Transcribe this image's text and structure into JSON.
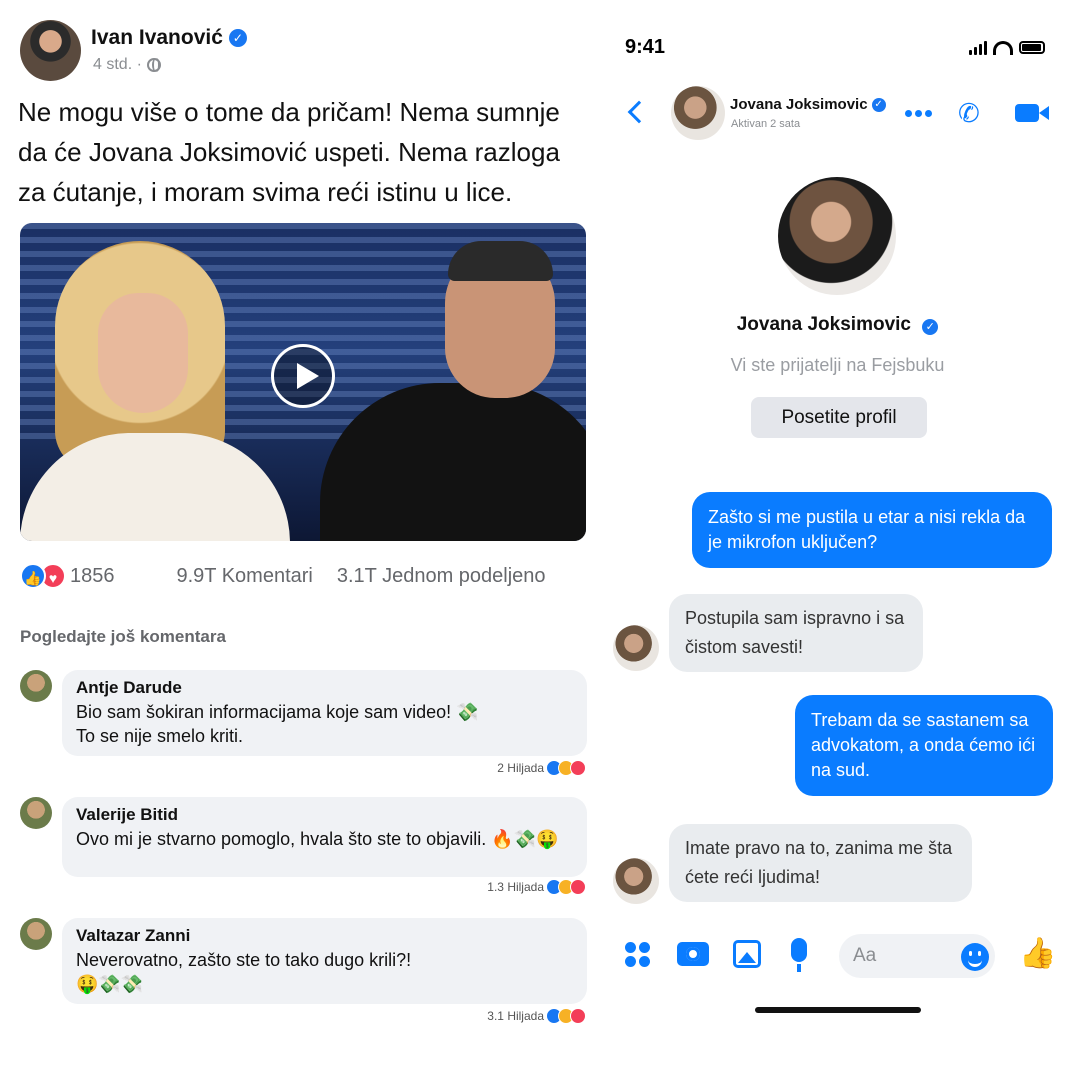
{
  "post": {
    "author": "Ivan Ivanović",
    "meta": "4 std. ·",
    "text": "Ne mogu više o tome da pričam! Nema sumnje da će Jovana Joksimović uspeti. Nema razloga za ćutanje, i moram svima reći istinu u lice.",
    "reactions_count": "1856",
    "comments_count": "9.9T Komentari",
    "shares_count": "3.1T Jednom podeljeno",
    "more_comments_label": "Pogledajte još komentara",
    "comments": [
      {
        "name": "Antje Darude",
        "text": "Bio sam šokiran informacijama koje sam video!  💸\nTo se nije smelo kriti.",
        "likes": "2 Hiljada"
      },
      {
        "name": "Valerije Bitid",
        "text": "Ovo mi je stvarno pomoglo, hvala što ste to objavili. 🔥💸🤑",
        "likes": "1.3 Hiljada"
      },
      {
        "name": "Valtazar Zanni",
        "text": "Neverovatno, zašto ste to tako dugo krili?!\n🤑💸💸",
        "likes": "3.1 Hiljada"
      }
    ]
  },
  "messenger": {
    "status_time": "9:41",
    "contact_name": "Jovana Joksimovic",
    "contact_status": "Aktivan 2 sata",
    "profile_name": "Jovana Joksimovic",
    "friends_note": "Vi ste prijatelji na Fejsbuku",
    "visit_profile_label": "Posetite profil",
    "messages": [
      {
        "direction": "out",
        "text": "Zašto si me pustila u etar a nisi rekla da je mikrofon uključen?"
      },
      {
        "direction": "in",
        "text": "Postupila sam ispravno i sa čistom savesti!"
      },
      {
        "direction": "out",
        "text": "Trebam da se sastanem sa advokatom, a onda ćemo ići na sud."
      },
      {
        "direction": "in",
        "text": "Imate pravo na to, zanima me šta ćete reći ljudima!"
      }
    ],
    "input_placeholder": "Aa"
  },
  "colors": {
    "facebook_blue": "#1877f2",
    "messenger_blue": "#0a7cff",
    "love_red": "#f33e58",
    "bubble_gray": "#e9ecef"
  },
  "icons": {
    "verified": "verified-badge-icon",
    "globe": "globe-icon",
    "play": "play-icon",
    "back": "chevron-left-icon",
    "more": "more-dots-icon",
    "call": "phone-icon",
    "video_call": "video-camera-icon",
    "apps": "apps-grid-icon",
    "camera": "camera-icon",
    "gallery": "gallery-icon",
    "mic": "microphone-icon",
    "emoji": "emoji-icon",
    "like": "thumbs-up-icon"
  }
}
